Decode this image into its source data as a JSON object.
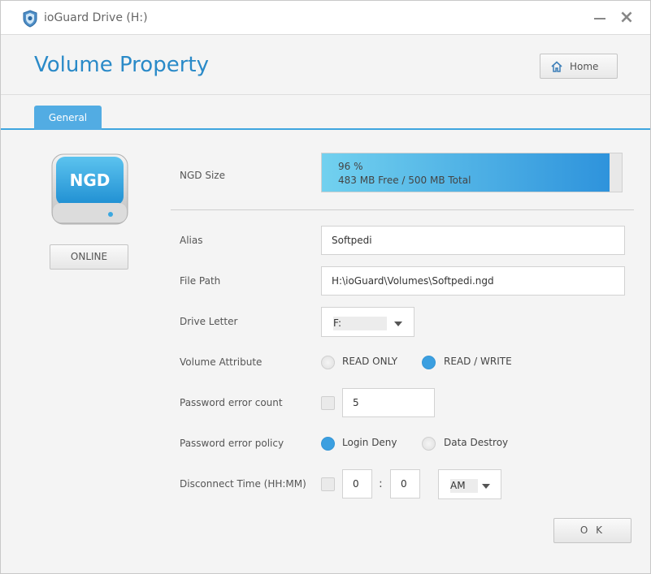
{
  "window": {
    "title": "ioGuard Drive (H:)"
  },
  "header": {
    "page_title": "Volume Property",
    "home_label": "Home"
  },
  "tabs": [
    {
      "label": "General",
      "selected": true
    }
  ],
  "drive": {
    "badge": "NGD",
    "status_button": "ONLINE"
  },
  "form": {
    "ngd_size": {
      "label": "NGD Size",
      "percent_text": "96 %",
      "percent_value": 96,
      "info": "483 MB Free / 500 MB Total"
    },
    "alias": {
      "label": "Alias",
      "value": "Softpedi"
    },
    "file_path": {
      "label": "File Path",
      "value": "H:\\ioGuard\\Volumes\\Softpedi.ngd"
    },
    "drive_letter": {
      "label": "Drive Letter",
      "value": "F:"
    },
    "volume_attribute": {
      "label": "Volume Attribute",
      "options": [
        {
          "label": "READ ONLY",
          "selected": false
        },
        {
          "label": "READ / WRITE",
          "selected": true
        }
      ]
    },
    "password_error_count": {
      "label": "Password error count",
      "checked": false,
      "value": "5"
    },
    "password_error_policy": {
      "label": "Password error policy",
      "options": [
        {
          "label": "Login Deny",
          "selected": true
        },
        {
          "label": "Data Destroy",
          "selected": false
        }
      ]
    },
    "disconnect_time": {
      "label": "Disconnect Time (HH:MM)",
      "checked": false,
      "hours": "0",
      "separator": ":",
      "minutes": "0",
      "ampm": "AM"
    }
  },
  "footer": {
    "ok_label": "O K"
  },
  "colors": {
    "accent": "#2a8ac8",
    "tab": "#52ace3",
    "radio_on": "#3b9fe0"
  }
}
